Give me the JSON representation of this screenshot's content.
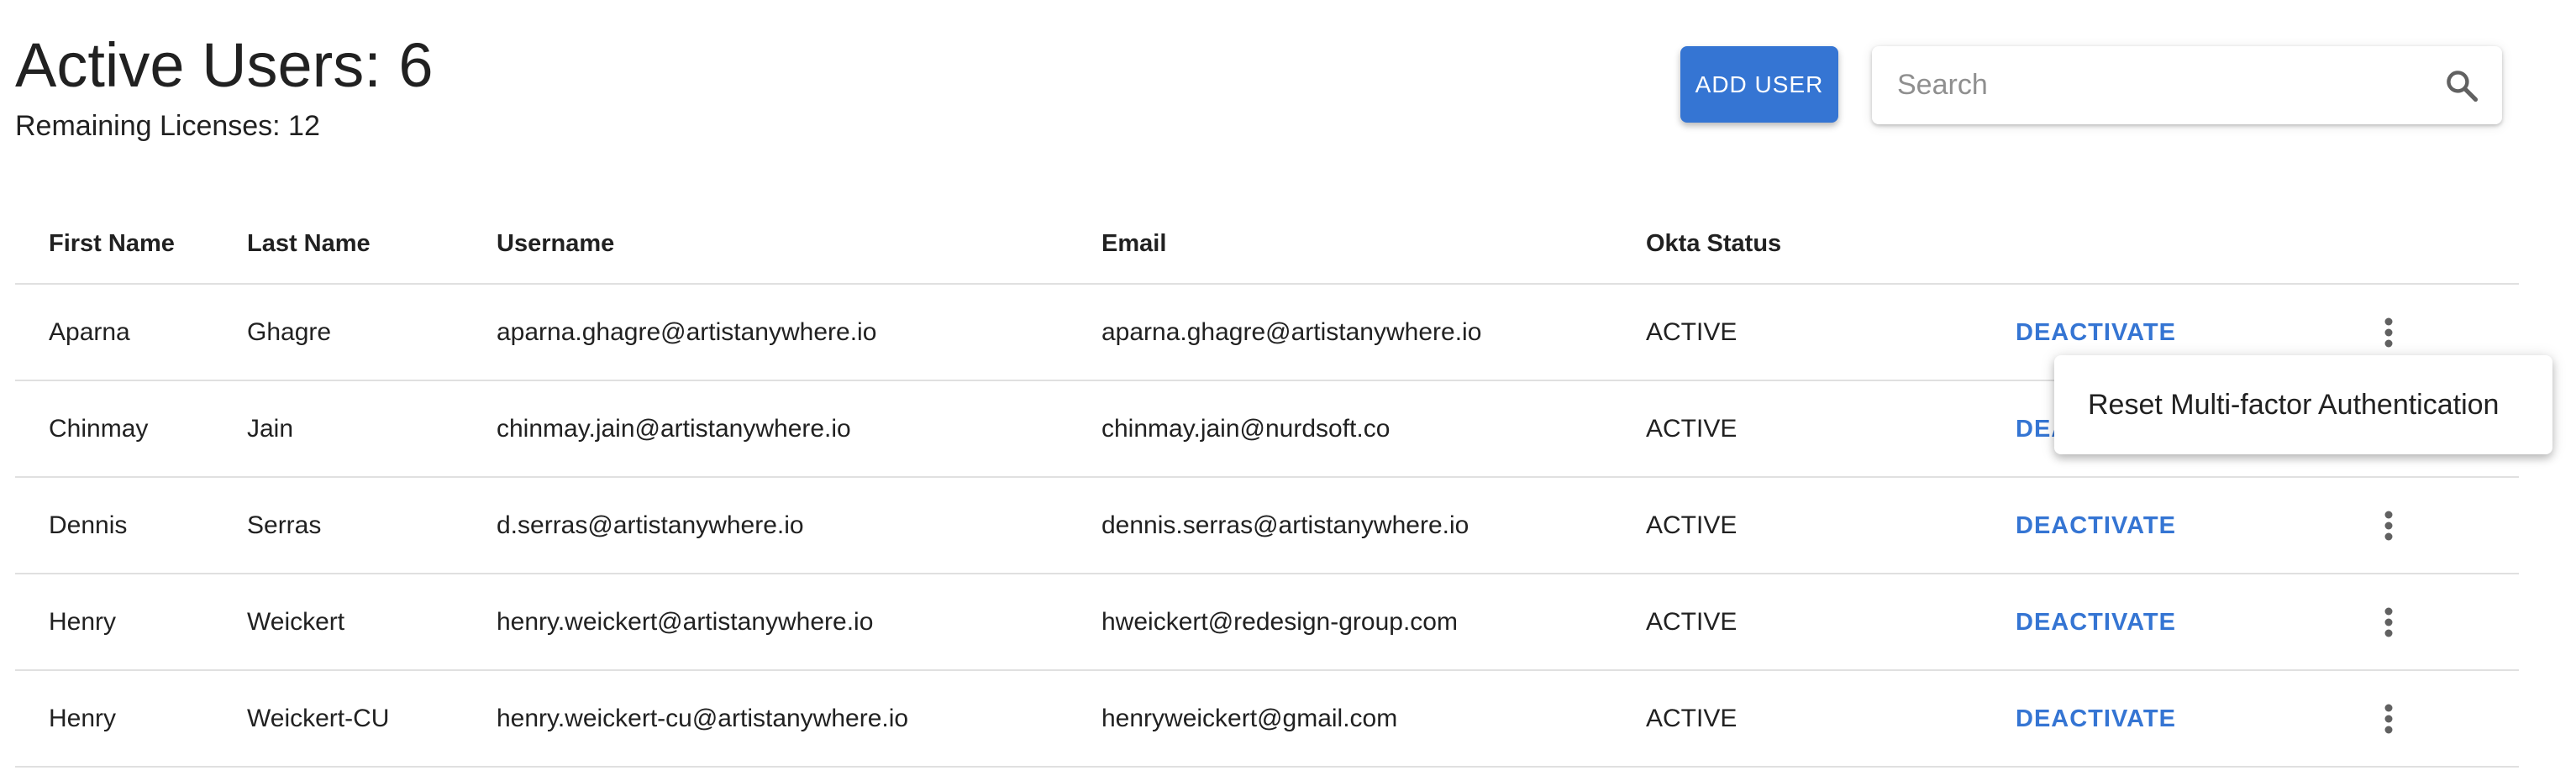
{
  "header": {
    "title": "Active Users: 6",
    "subtitle": "Remaining Licenses: 12"
  },
  "toolbar": {
    "add_user_label": "ADD USER",
    "search_placeholder": "Search",
    "search_value": "",
    "search_icon": "magnifier-icon"
  },
  "table": {
    "columns": [
      "First Name",
      "Last Name",
      "Username",
      "Email",
      "Okta Status",
      "",
      ""
    ],
    "action_label": "DEACTIVATE",
    "more_icon": "vertical-dots-icon",
    "rows": [
      {
        "first_name": "Aparna",
        "last_name": "Ghagre",
        "username": "aparna.ghagre@artistanywhere.io",
        "email": "aparna.ghagre@artistanywhere.io",
        "status": "ACTIVE"
      },
      {
        "first_name": "Chinmay",
        "last_name": "Jain",
        "username": "chinmay.jain@artistanywhere.io",
        "email": "chinmay.jain@nurdsoft.co",
        "status": "ACTIVE"
      },
      {
        "first_name": "Dennis",
        "last_name": "Serras",
        "username": "d.serras@artistanywhere.io",
        "email": "dennis.serras@artistanywhere.io",
        "status": "ACTIVE"
      },
      {
        "first_name": "Henry",
        "last_name": "Weickert",
        "username": "henry.weickert@artistanywhere.io",
        "email": "hweickert@redesign-group.com",
        "status": "ACTIVE"
      },
      {
        "first_name": "Henry",
        "last_name": "Weickert-CU",
        "username": "henry.weickert-cu@artistanywhere.io",
        "email": "henryweickert@gmail.com",
        "status": "ACTIVE"
      }
    ]
  },
  "row_menu": {
    "items": [
      "Reset Multi-factor Authentication"
    ]
  },
  "colors": {
    "accent": "#3575d3",
    "text": "#212121",
    "divider": "#e0e0e0",
    "placeholder": "#8f8f8f",
    "icon": "#616161"
  }
}
